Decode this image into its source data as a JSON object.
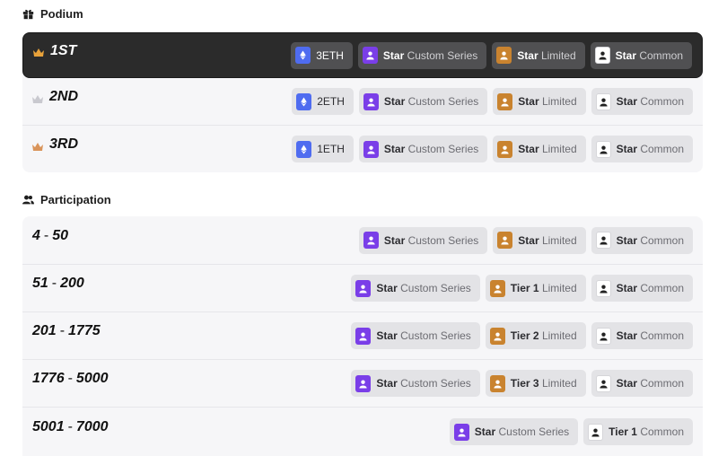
{
  "podium": {
    "title": "Podium",
    "rows": [
      {
        "rank": "1ST",
        "crown": "gold-crown-icon",
        "eth": "3ETH",
        "rewards": [
          {
            "bold": "Star",
            "rest": " Custom Series",
            "tier": "custom"
          },
          {
            "bold": "Star",
            "rest": " Limited",
            "tier": "limited"
          },
          {
            "bold": "Star",
            "rest": " Common",
            "tier": "common"
          }
        ]
      },
      {
        "rank": "2ND",
        "crown": "silver-crown-icon",
        "eth": "2ETH",
        "rewards": [
          {
            "bold": "Star",
            "rest": " Custom Series",
            "tier": "custom"
          },
          {
            "bold": "Star",
            "rest": " Limited",
            "tier": "limited"
          },
          {
            "bold": "Star",
            "rest": " Common",
            "tier": "common"
          }
        ]
      },
      {
        "rank": "3RD",
        "crown": "bronze-crown-icon",
        "eth": "1ETH",
        "rewards": [
          {
            "bold": "Star",
            "rest": " Custom Series",
            "tier": "custom"
          },
          {
            "bold": "Star",
            "rest": " Limited",
            "tier": "limited"
          },
          {
            "bold": "Star",
            "rest": " Common",
            "tier": "common"
          }
        ]
      }
    ]
  },
  "participation": {
    "title": "Participation",
    "rows": [
      {
        "from": "4",
        "to": "50",
        "rewards": [
          {
            "bold": "Star",
            "rest": " Custom Series",
            "tier": "custom"
          },
          {
            "bold": "Star",
            "rest": " Limited",
            "tier": "limited"
          },
          {
            "bold": "Star",
            "rest": " Common",
            "tier": "common"
          }
        ]
      },
      {
        "from": "51",
        "to": "200",
        "rewards": [
          {
            "bold": "Star",
            "rest": " Custom Series",
            "tier": "custom"
          },
          {
            "bold": "Tier 1",
            "rest": " Limited",
            "tier": "limited"
          },
          {
            "bold": "Star",
            "rest": " Common",
            "tier": "common"
          }
        ]
      },
      {
        "from": "201",
        "to": "1775",
        "rewards": [
          {
            "bold": "Star",
            "rest": " Custom Series",
            "tier": "custom"
          },
          {
            "bold": "Tier 2",
            "rest": " Limited",
            "tier": "limited"
          },
          {
            "bold": "Star",
            "rest": " Common",
            "tier": "common"
          }
        ]
      },
      {
        "from": "1776",
        "to": "5000",
        "rewards": [
          {
            "bold": "Star",
            "rest": " Custom Series",
            "tier": "custom"
          },
          {
            "bold": "Tier 3",
            "rest": " Limited",
            "tier": "limited"
          },
          {
            "bold": "Star",
            "rest": " Common",
            "tier": "common"
          }
        ]
      },
      {
        "from": "5001",
        "to": "7000",
        "rewards": [
          {
            "bold": "Star",
            "rest": " Custom Series",
            "tier": "custom"
          },
          {
            "bold": "Tier 1",
            "rest": " Common",
            "tier": "common"
          }
        ]
      }
    ]
  },
  "colors": {
    "custom": "#7a3ee8",
    "limited": "#c9832f",
    "common": "#ffffff",
    "eth": "#4f6cf0",
    "gold_crown": "#e8a23a",
    "silver_crown": "#c9c9cf",
    "bronze_crown": "#d9945a"
  }
}
